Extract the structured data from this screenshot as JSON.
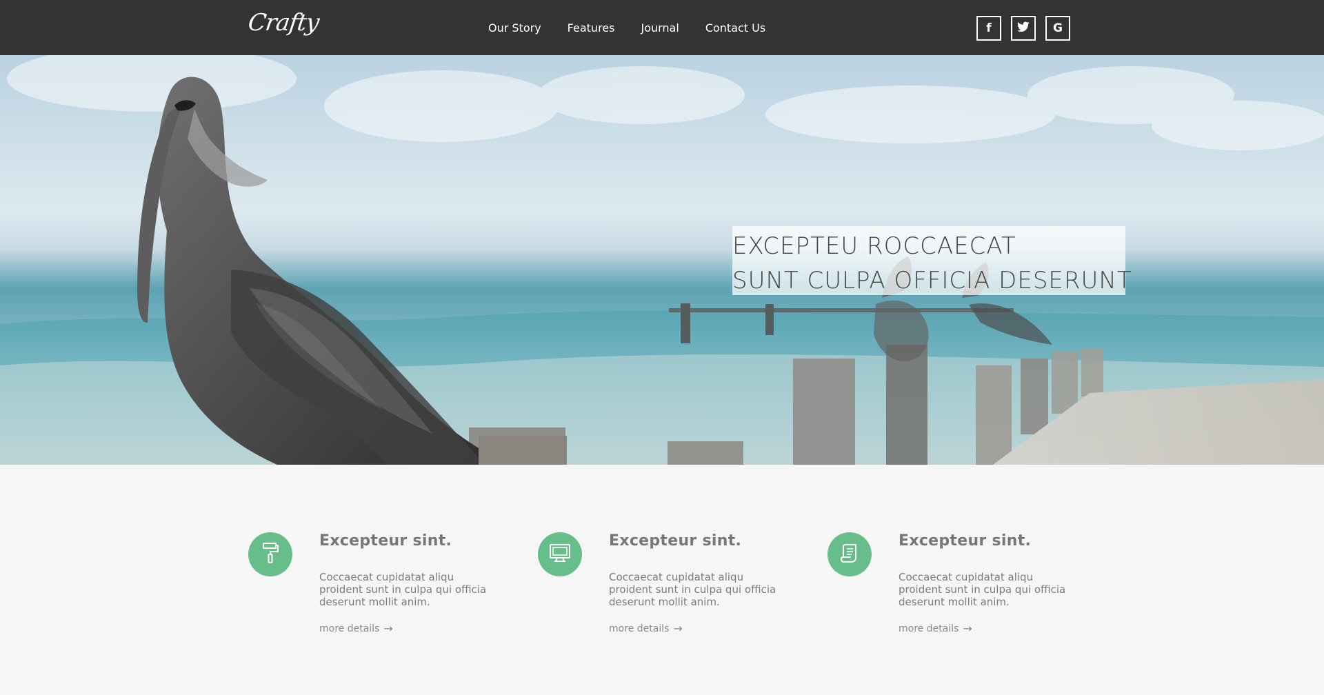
{
  "header": {
    "logo": "Crafty",
    "nav": [
      "Our Story",
      "Features",
      "Journal",
      "Contact Us"
    ],
    "social": [
      {
        "icon": "facebook-icon",
        "glyph": "f"
      },
      {
        "icon": "twitter-icon",
        "glyph": "t"
      },
      {
        "icon": "google-icon",
        "glyph": "G"
      }
    ]
  },
  "hero": {
    "line1": "EXCEPTEU ROCCAECAT",
    "line2": "SUNT CULPA OFFICIA DESERUNT"
  },
  "features": [
    {
      "icon": "paint-roller-icon",
      "title": "Excepteur sint.",
      "desc": "Coccaecat cupidatat aliqu proident sunt in culpa qui officia deserunt mollit anim.",
      "more": "more details",
      "arrow": "→"
    },
    {
      "icon": "monitor-icon",
      "title": "Excepteur sint.",
      "desc": "Coccaecat cupidatat aliqu proident sunt in culpa qui officia deserunt mollit anim.",
      "more": "more details",
      "arrow": "→"
    },
    {
      "icon": "scroll-icon",
      "title": "Excepteur sint.",
      "desc": "Coccaecat cupidatat aliqu proident sunt in culpa qui officia deserunt mollit anim.",
      "more": "more details",
      "arrow": "→"
    }
  ],
  "colors": {
    "topbar": "#333333",
    "accent": "#67be8a",
    "page_bg": "#f6f6f6"
  }
}
